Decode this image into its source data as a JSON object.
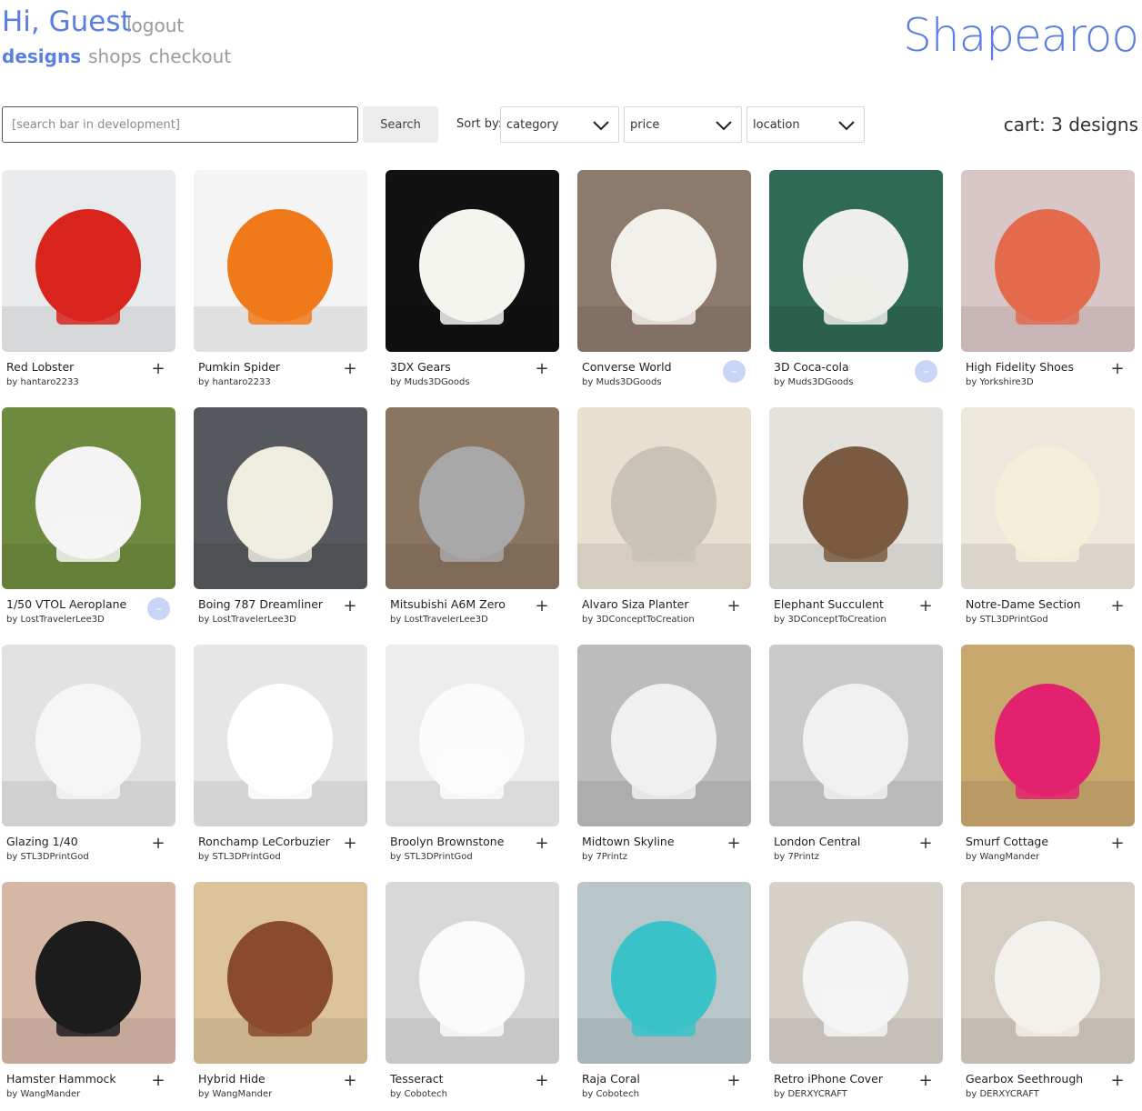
{
  "header": {
    "greeting": "Hi, Guest",
    "logout": "logout",
    "nav": [
      "designs",
      "shops",
      "checkout"
    ],
    "active_nav": "designs",
    "brand": "Shapearoo"
  },
  "toolbar": {
    "search_placeholder": "[search bar in development]",
    "search_button": "Search",
    "sort_label": "Sort by:",
    "sort_category": "category",
    "sort_price": "price",
    "sort_location": "location",
    "cart": "cart: 3 designs"
  },
  "colors": {
    "accent": "#5b7fe0",
    "in_cart_button": "#c9d5f6",
    "muted": "#9a9a9a"
  },
  "designs": [
    {
      "title": "Red Lobster",
      "author": "by hantaro2233",
      "in_cart": false,
      "bg": "#e9eaec",
      "fg": "#d8241c",
      "icon": "plus-icon"
    },
    {
      "title": "Pumkin Spider",
      "author": "by hantaro2233",
      "in_cart": false,
      "bg": "#f4f4f4",
      "fg": "#f07a1a",
      "icon": "plus-icon"
    },
    {
      "title": "3DX Gears",
      "author": "by Muds3DGoods",
      "in_cart": false,
      "bg": "#111111",
      "fg": "#f5f5f0",
      "icon": "plus-icon"
    },
    {
      "title": "Converse World",
      "author": "by Muds3DGoods",
      "in_cart": true,
      "bg": "#8c7a6c",
      "fg": "#f2f0ea",
      "icon": "minus-icon"
    },
    {
      "title": "3D Coca-cola",
      "author": "by Muds3DGoods",
      "in_cart": true,
      "bg": "#2f6a52",
      "fg": "#eeeeea",
      "icon": "minus-icon"
    },
    {
      "title": "High Fidelity Shoes",
      "author": "by Yorkshire3D",
      "in_cart": false,
      "bg": "#d9c6c6",
      "fg": "#e46a4e",
      "icon": "plus-icon"
    },
    {
      "title": "1/50 VTOL Aeroplane",
      "author": "by LostTravelerLee3D",
      "in_cart": true,
      "bg": "#6e8a3e",
      "fg": "#f4f4f4",
      "icon": "minus-icon"
    },
    {
      "title": "Boing 787 Dreamliner",
      "author": "by LostTravelerLee3D",
      "in_cart": false,
      "bg": "#55585c",
      "fg": "#efece0",
      "icon": "plus-icon"
    },
    {
      "title": "Mitsubishi A6M Zero",
      "author": "by LostTravelerLee3D",
      "in_cart": false,
      "bg": "#8a7560",
      "fg": "#a8a8a8",
      "icon": "plus-icon"
    },
    {
      "title": "Alvaro Siza Planter",
      "author": "by 3DConceptToCreation",
      "in_cart": false,
      "bg": "#e8dfd0",
      "fg": "#c9c2b6",
      "icon": "plus-icon"
    },
    {
      "title": "Elephant Succulent",
      "author": "by 3DConceptToCreation",
      "in_cart": false,
      "bg": "#e4e2dc",
      "fg": "#7a5a40",
      "icon": "plus-icon"
    },
    {
      "title": "Notre-Dame Section",
      "author": "by STL3DPrintGod",
      "in_cart": false,
      "bg": "#ece8dc",
      "fg": "#f3efd8",
      "icon": "plus-icon"
    },
    {
      "title": "Glazing 1/40",
      "author": "by STL3DPrintGod",
      "in_cart": false,
      "bg": "#e2e2e2",
      "fg": "#f6f6f6",
      "icon": "plus-icon"
    },
    {
      "title": "Ronchamp LeCorbuzier",
      "author": "by STL3DPrintGod",
      "in_cart": false,
      "bg": "#e6e6e6",
      "fg": "#ffffff",
      "icon": "plus-icon"
    },
    {
      "title": "Broolyn Brownstone",
      "author": "by STL3DPrintGod",
      "in_cart": false,
      "bg": "#ededed",
      "fg": "#fbfbfb",
      "icon": "plus-icon"
    },
    {
      "title": "Midtown Skyline",
      "author": "by 7Printz",
      "in_cart": false,
      "bg": "#bcbcbc",
      "fg": "#f0f0f0",
      "icon": "plus-icon"
    },
    {
      "title": "London Central",
      "author": "by 7Printz",
      "in_cart": false,
      "bg": "#c9c9c9",
      "fg": "#f1f1f1",
      "icon": "plus-icon"
    },
    {
      "title": "Smurf Cottage",
      "author": "by WangMander",
      "in_cart": false,
      "bg": "#c9a86d",
      "fg": "#e3226f",
      "icon": "plus-icon"
    },
    {
      "title": "Hamster Hammock",
      "author": "by WangMander",
      "in_cart": false,
      "bg": "#d6b7a6",
      "fg": "#1c1c1c",
      "icon": "plus-icon"
    },
    {
      "title": "Hybrid Hide",
      "author": "by WangMander",
      "in_cart": false,
      "bg": "#dcc39a",
      "fg": "#8a4a2c",
      "icon": "plus-icon"
    },
    {
      "title": "Tesseract",
      "author": "by Cobotech",
      "in_cart": false,
      "bg": "#d8d8d8",
      "fg": "#fafafa",
      "icon": "plus-icon"
    },
    {
      "title": "Raja Coral",
      "author": "by Cobotech",
      "in_cart": false,
      "bg": "#b8c6c9",
      "fg": "#39c3c8",
      "icon": "plus-icon"
    },
    {
      "title": "Retro iPhone Cover",
      "author": "by DERXYCRAFT",
      "in_cart": false,
      "bg": "#d5d0c8",
      "fg": "#f4f4f4",
      "icon": "plus-icon"
    },
    {
      "title": "Gearbox Seethrough",
      "author": "by DERXYCRAFT",
      "in_cart": false,
      "bg": "#d4cdc2",
      "fg": "#f3f1ec",
      "icon": "plus-icon"
    }
  ]
}
